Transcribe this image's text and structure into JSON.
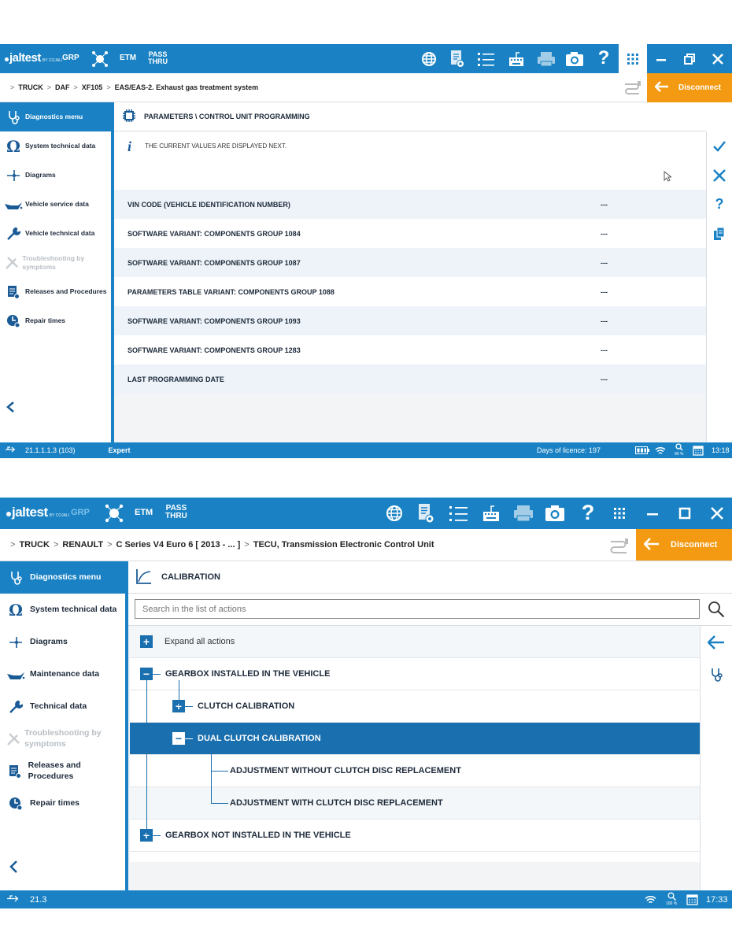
{
  "screen1": {
    "topbar": {
      "logo": "jaltest",
      "logo_sub": "BY COJALI",
      "grp": "GRP",
      "etm": "ETM",
      "pass": "PASS",
      "thru": "THRU"
    },
    "breadcrumb": [
      "TRUCK",
      "DAF",
      "XF105",
      "EAS/EAS-2. Exhaust gas treatment system"
    ],
    "disconnect": "Disconnect",
    "sidebar": [
      {
        "label": "Diagnostics menu",
        "icon": "stethoscope-icon",
        "state": "active"
      },
      {
        "label": "System technical data",
        "icon": "omega-icon",
        "state": "normal"
      },
      {
        "label": "Diagrams",
        "icon": "diagram-icon",
        "state": "normal"
      },
      {
        "label": "Vehicle service data",
        "icon": "oil-can-icon",
        "state": "normal"
      },
      {
        "label": "Vehicle technical data",
        "icon": "wrench-icon",
        "state": "normal"
      },
      {
        "label": "Troubleshooting by symptoms",
        "icon": "tools-icon",
        "state": "disabled"
      },
      {
        "label": "Releases and Procedures",
        "icon": "document-icon",
        "state": "normal"
      },
      {
        "label": "Repair times",
        "icon": "clock-icon",
        "state": "normal"
      }
    ],
    "header_title": "PARAMETERS \\ CONTROL UNIT PROGRAMMING",
    "info_text": "THE CURRENT VALUES ARE DISPLAYED NEXT.",
    "params": [
      {
        "name": "VIN CODE (VEHICLE IDENTIFICATION NUMBER)",
        "value": "---"
      },
      {
        "name": "SOFTWARE VARIANT: COMPONENTS GROUP 1084",
        "value": "---"
      },
      {
        "name": "SOFTWARE VARIANT: COMPONENTS GROUP 1087",
        "value": "---"
      },
      {
        "name": "PARAMETERS TABLE VARIANT: COMPONENTS GROUP 1088",
        "value": "---"
      },
      {
        "name": "SOFTWARE VARIANT: COMPONENTS GROUP 1093",
        "value": "---"
      },
      {
        "name": "SOFTWARE VARIANT: COMPONENTS GROUP 1283",
        "value": "---"
      },
      {
        "name": "LAST PROGRAMMING DATE",
        "value": "---"
      }
    ],
    "status": {
      "version": "21.1.1.1.3 (103)",
      "mode": "Expert",
      "licence": "Days of licence: 197",
      "zoom": "90 %",
      "time": "13:18"
    }
  },
  "screen2": {
    "topbar": {
      "logo": "jaltest",
      "logo_sub": "BY COJALI",
      "grp": "GRP",
      "etm": "ETM",
      "pass": "PASS",
      "thru": "THRU"
    },
    "breadcrumb": [
      "TRUCK",
      "RENAULT",
      "C Series V4 Euro 6 [ 2013 - ... ]",
      "TECU, Transmission Electronic Control Unit"
    ],
    "disconnect": "Disconnect",
    "sidebar": [
      {
        "label": "Diagnostics menu",
        "icon": "stethoscope-icon",
        "state": "active"
      },
      {
        "label": "System technical data",
        "icon": "omega-icon",
        "state": "normal"
      },
      {
        "label": "Diagrams",
        "icon": "diagram-icon",
        "state": "normal"
      },
      {
        "label": "Maintenance data",
        "icon": "oil-can-icon",
        "state": "normal"
      },
      {
        "label": "Technical data",
        "icon": "wrench-icon",
        "state": "normal"
      },
      {
        "label": "Troubleshooting by symptoms",
        "icon": "tools-icon",
        "state": "disabled"
      },
      {
        "label": "Releases and Procedures",
        "icon": "document-icon",
        "state": "normal"
      },
      {
        "label": "Repair times",
        "icon": "clock-icon",
        "state": "normal"
      }
    ],
    "header_title": "CALIBRATION",
    "search_placeholder": "Search in the list of actions",
    "expand_all": "Expand all actions",
    "tree": [
      "GEARBOX INSTALLED IN THE VEHICLE",
      "CLUTCH CALIBRATION",
      "DUAL CLUTCH CALIBRATION",
      "ADJUSTMENT WITHOUT CLUTCH DISC REPLACEMENT",
      "ADJUSTMENT WITH CLUTCH DISC REPLACEMENT",
      "GEARBOX NOT INSTALLED IN THE VEHICLE"
    ],
    "status": {
      "version": "21.3",
      "zoom": "100 %",
      "time": "17:33"
    }
  }
}
